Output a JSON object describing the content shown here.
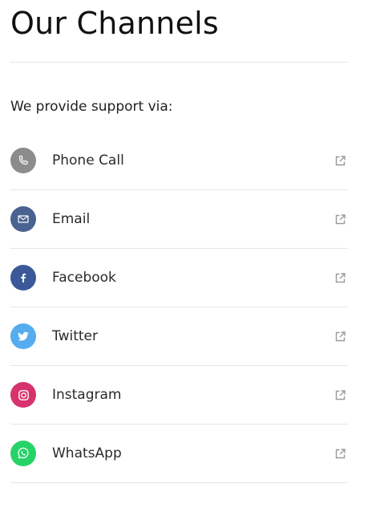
{
  "header": {
    "title": "Our Channels"
  },
  "intro": {
    "text": "We provide support via:"
  },
  "channels": [
    {
      "label": "Phone Call",
      "icon": "phone-icon",
      "color": "#8c8c8c"
    },
    {
      "label": "Email",
      "icon": "envelope-icon",
      "color": "#4a6290"
    },
    {
      "label": "Facebook",
      "icon": "facebook-icon",
      "color": "#3b5998"
    },
    {
      "label": "Twitter",
      "icon": "twitter-icon",
      "color": "#55acee"
    },
    {
      "label": "Instagram",
      "icon": "instagram-icon",
      "color": "#d6336c"
    },
    {
      "label": "WhatsApp",
      "icon": "whatsapp-icon",
      "color": "#25d366"
    }
  ],
  "external_link_icon": "external-link-icon",
  "colors": {
    "divider": "#e6e6e6",
    "external_icon": "#9a9a9a"
  }
}
